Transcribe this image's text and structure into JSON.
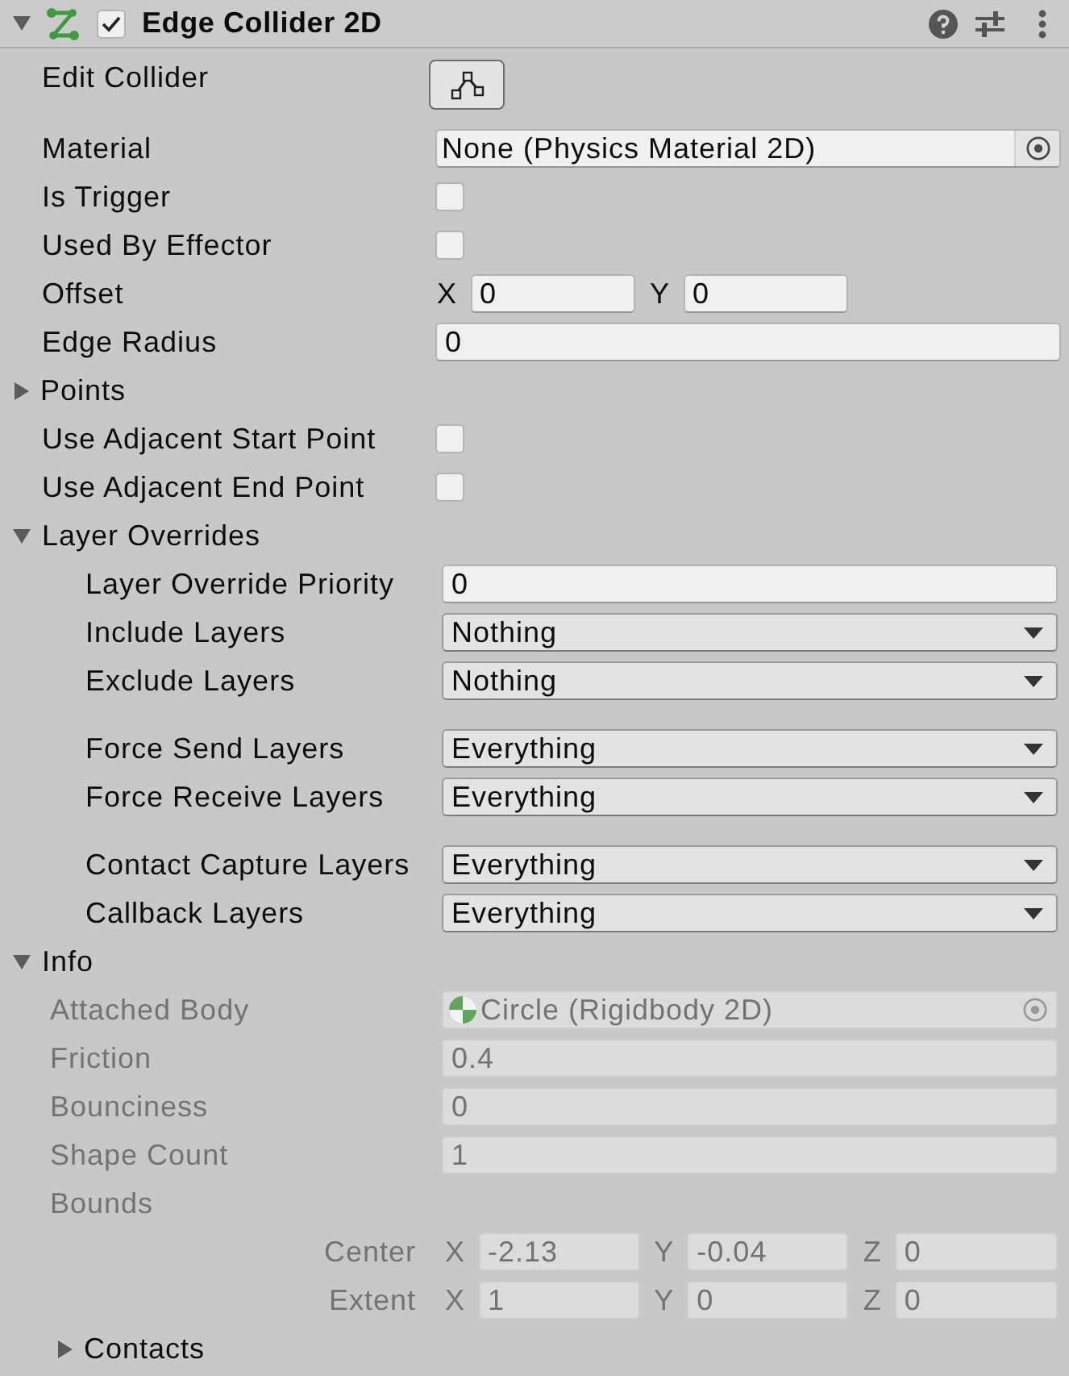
{
  "component": {
    "title": "Edge Collider 2D",
    "expanded": true,
    "enabled": true
  },
  "properties": [
    {
      "kind": "button",
      "label": "Edit Collider"
    },
    {
      "kind": "object",
      "label": "Material",
      "value": "None (Physics Material 2D)",
      "assigned": false
    },
    {
      "kind": "checkbox",
      "label": "Is Trigger",
      "checked": false
    },
    {
      "kind": "checkbox",
      "label": "Used By Effector",
      "checked": false
    },
    {
      "kind": "vector",
      "label": "Offset",
      "components": [
        {
          "axis": "X",
          "value": "0"
        },
        {
          "axis": "Y",
          "value": "0"
        }
      ]
    },
    {
      "kind": "number",
      "label": "Edge Radius",
      "value": "0"
    },
    {
      "kind": "foldout",
      "label": "Points",
      "expanded": false
    },
    {
      "kind": "checkbox",
      "label": "Use Adjacent Start Point",
      "checked": false
    },
    {
      "kind": "checkbox",
      "label": "Use Adjacent End Point",
      "checked": false
    },
    {
      "kind": "foldout",
      "label": "Layer Overrides",
      "expanded": true,
      "groups": [
        [
          {
            "kind": "number",
            "label": "Layer Override Priority",
            "value": "0"
          },
          {
            "kind": "dropdown",
            "label": "Include Layers",
            "value": "Nothing"
          },
          {
            "kind": "dropdown",
            "label": "Exclude Layers",
            "value": "Nothing"
          }
        ],
        [
          {
            "kind": "dropdown",
            "label": "Force Send Layers",
            "value": "Everything"
          },
          {
            "kind": "dropdown",
            "label": "Force Receive Layers",
            "value": "Everything"
          }
        ],
        [
          {
            "kind": "dropdown",
            "label": "Contact Capture Layers",
            "value": "Everything"
          },
          {
            "kind": "dropdown",
            "label": "Callback Layers",
            "value": "Everything"
          }
        ]
      ]
    },
    {
      "kind": "foldout",
      "label": "Info",
      "expanded": true,
      "groups": [
        [
          {
            "kind": "object",
            "label": "Attached Body",
            "value": "Circle (Rigidbody 2D)",
            "assigned": true,
            "disabled": true
          },
          {
            "kind": "number",
            "label": "Friction",
            "value": "0.4",
            "disabled": true
          },
          {
            "kind": "number",
            "label": "Bounciness",
            "value": "0",
            "disabled": true
          },
          {
            "kind": "number",
            "label": "Shape Count",
            "value": "1",
            "disabled": true
          },
          {
            "kind": "bounds",
            "label": "Bounds",
            "disabled": true,
            "rows": [
              {
                "label": "Center",
                "components": [
                  {
                    "axis": "X",
                    "value": "-2.13"
                  },
                  {
                    "axis": "Y",
                    "value": "-0.04"
                  },
                  {
                    "axis": "Z",
                    "value": "0"
                  }
                ]
              },
              {
                "label": "Extent",
                "components": [
                  {
                    "axis": "X",
                    "value": "1"
                  },
                  {
                    "axis": "Y",
                    "value": "0"
                  },
                  {
                    "axis": "Z",
                    "value": "0"
                  }
                ]
              }
            ]
          },
          {
            "kind": "foldout",
            "label": "Contacts",
            "expanded": false,
            "disabled": false
          }
        ]
      ]
    }
  ]
}
